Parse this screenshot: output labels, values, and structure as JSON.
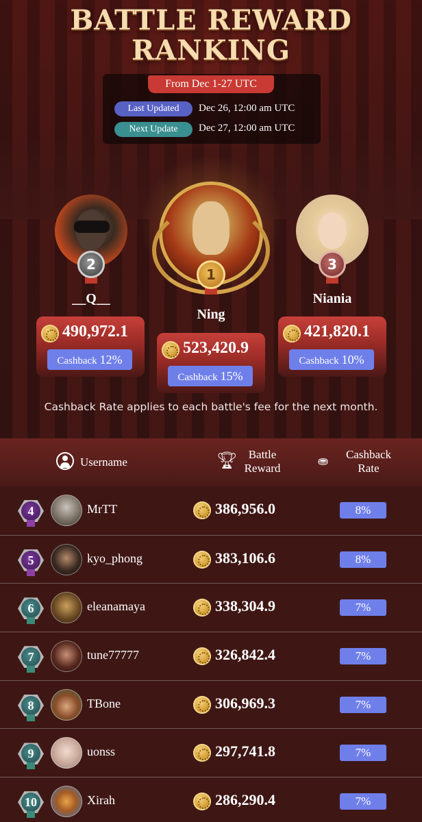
{
  "header": {
    "title_line1": "BATTLE REWARD",
    "title_line2": "RANKING",
    "period": "From Dec 1-27 UTC",
    "last_updated_label": "Last Updated",
    "last_updated_value": "Dec 26, 12:00 am UTC",
    "next_update_label": "Next Update",
    "next_update_value": "Dec 27, 12:00 am UTC"
  },
  "podium": [
    {
      "rank": "2",
      "username": "__Q__",
      "reward": "490,972.1",
      "cashback_label": "Cashback",
      "cashback_rate": "12%"
    },
    {
      "rank": "1",
      "username": "Ning",
      "reward": "523,420.9",
      "cashback_label": "Cashback",
      "cashback_rate": "15%"
    },
    {
      "rank": "3",
      "username": "Niania",
      "reward": "421,820.1",
      "cashback_label": "Cashback",
      "cashback_rate": "10%"
    }
  ],
  "note": "Cashback Rate applies to each battle's fee for the next month.",
  "table": {
    "columns": {
      "username": "Username",
      "reward_line1": "Battle",
      "reward_line2": "Reward",
      "rate_line1": "Cashback",
      "rate_line2": "Rate"
    },
    "rows": [
      {
        "rank": "4",
        "username": "MrTT",
        "reward": "386,956.0",
        "rate": "8%"
      },
      {
        "rank": "5",
        "username": "kyo_phong",
        "reward": "383,106.6",
        "rate": "8%"
      },
      {
        "rank": "6",
        "username": "eleanamaya",
        "reward": "338,304.9",
        "rate": "7%"
      },
      {
        "rank": "7",
        "username": "tune77777",
        "reward": "326,842.4",
        "rate": "7%"
      },
      {
        "rank": "8",
        "username": "TBone",
        "reward": "306,969.3",
        "rate": "7%"
      },
      {
        "rank": "9",
        "username": "uonss",
        "reward": "297,741.8",
        "rate": "7%"
      },
      {
        "rank": "10",
        "username": "Xirah",
        "reward": "286,290.4",
        "rate": "7%"
      }
    ]
  },
  "icons": {
    "coin": "gold-coin-icon",
    "user": "user-icon",
    "trophy": "trophy-icon",
    "cashback": "cashback-icon"
  },
  "colors": {
    "background": "#3e1715",
    "accent_red": "#c83a33",
    "cashback_blue": "#6f7fea",
    "gold": "#d8aa4e"
  }
}
